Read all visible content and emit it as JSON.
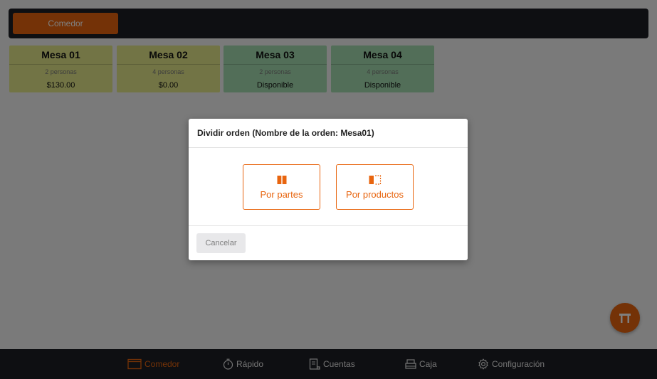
{
  "topbar": {
    "area_tab": "Comedor"
  },
  "tables": [
    {
      "name": "Mesa 01",
      "people": "2 personas",
      "status": "$130.00",
      "state": "occupied"
    },
    {
      "name": "Mesa 02",
      "people": "4 personas",
      "status": "$0.00",
      "state": "occupied"
    },
    {
      "name": "Mesa 03",
      "people": "2 personas",
      "status": "Disponible",
      "state": "free"
    },
    {
      "name": "Mesa 04",
      "people": "4 personas",
      "status": "Disponible",
      "state": "free"
    }
  ],
  "bottom_nav": {
    "items": [
      {
        "label": "Comedor",
        "icon": "table-frame-icon",
        "active": true
      },
      {
        "label": "Rápido",
        "icon": "stopwatch-icon",
        "active": false
      },
      {
        "label": "Cuentas",
        "icon": "receipt-icon",
        "active": false
      },
      {
        "label": "Caja",
        "icon": "cash-register-icon",
        "active": false
      },
      {
        "label": "Configuración",
        "icon": "gear-icon",
        "active": false
      }
    ]
  },
  "fab": {
    "icon": "table-icon"
  },
  "modal": {
    "title": "Dividir orden (Nombre de la orden: Mesa01)",
    "options": [
      {
        "label": "Por partes",
        "icon": "split-parts-icon"
      },
      {
        "label": "Por productos",
        "icon": "split-products-icon"
      }
    ],
    "cancel_label": "Cancelar"
  },
  "colors": {
    "accent": "#e8650f",
    "dark_bar": "#1d1f24",
    "occupied_table": "#e4e98a",
    "free_table": "#a4ddb0",
    "overlay": "rgba(0,0,0,0.5)"
  }
}
